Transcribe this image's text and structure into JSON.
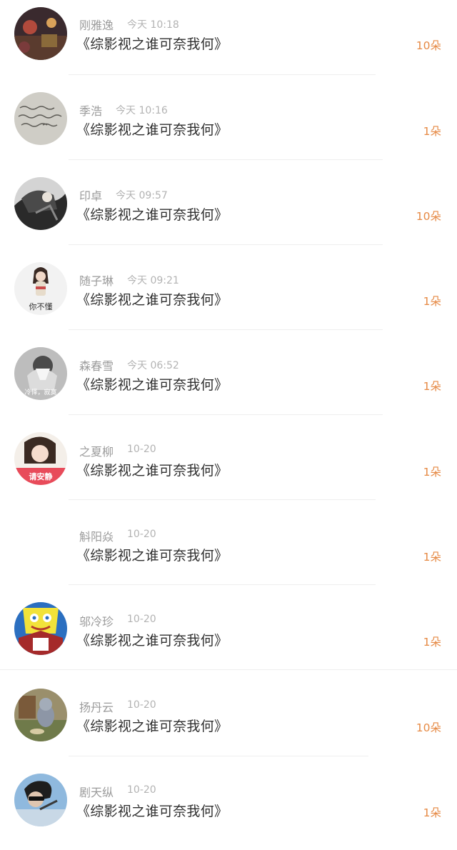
{
  "items": [
    {
      "name": "刚雅逸",
      "time": "今天 10:18",
      "title": "《综影视之谁可奈我何》",
      "count": "10朵"
    },
    {
      "name": "季浩",
      "time": "今天 10:16",
      "title": "《综影视之谁可奈我何》",
      "count": "1朵"
    },
    {
      "name": "印卓",
      "time": "今天 09:57",
      "title": "《综影视之谁可奈我何》",
      "count": "10朵"
    },
    {
      "name": "随子琳",
      "time": "今天 09:21",
      "title": "《综影视之谁可奈我何》",
      "count": "1朵"
    },
    {
      "name": "森春雪",
      "time": "今天 06:52",
      "title": "《综影视之谁可奈我何》",
      "count": "1朵"
    },
    {
      "name": "之夏柳",
      "time": "10-20",
      "title": "《综影视之谁可奈我何》",
      "count": "1朵"
    },
    {
      "name": "斛阳焱",
      "time": "10-20",
      "title": "《综影视之谁可奈我何》",
      "count": "1朵"
    },
    {
      "name": "邬冷珍",
      "time": "10-20",
      "title": "《综影视之谁可奈我何》",
      "count": "1朵"
    },
    {
      "name": "扬丹云",
      "time": "10-20",
      "title": "《综影视之谁可奈我何》",
      "count": "10朵"
    },
    {
      "name": "剧天纵",
      "time": "10-20",
      "title": "《综影视之谁可奈我何》",
      "count": "1朵"
    }
  ],
  "avatar_texts": {
    "avatar_4": "你不懂",
    "avatar_5": "冷怿，寂寞",
    "avatar_6": "请安静"
  },
  "colors": {
    "name": "#9b9b9b",
    "time": "#b3b3b3",
    "title": "#2f2f2f",
    "count": "#e68a45",
    "divider": "#efefef"
  }
}
